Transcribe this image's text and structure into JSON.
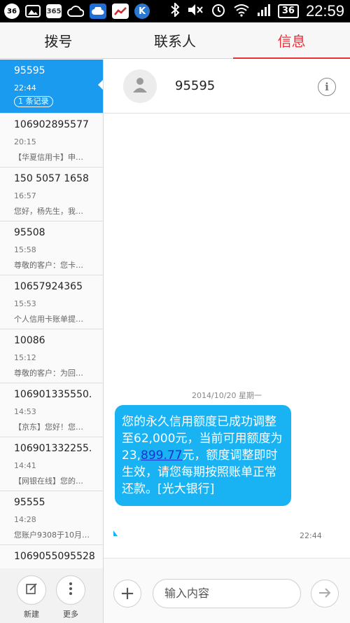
{
  "status_bar": {
    "icons": [
      "notification-badge-36",
      "image-icon",
      "calendar-365-icon",
      "cloud-icon",
      "cloud-sync-icon",
      "chart-icon",
      "k-icon"
    ],
    "calendar_label": "365",
    "notif_label": "36",
    "k_label": "K",
    "battery": "36",
    "time": "22:59"
  },
  "tabs": [
    {
      "label": "拨号",
      "active": false
    },
    {
      "label": "联系人",
      "active": false
    },
    {
      "label": "信息",
      "active": true
    }
  ],
  "conversations": [
    {
      "name": "95595",
      "time": "22:44",
      "snippet": "",
      "badge": "1 条记录",
      "selected": true
    },
    {
      "name": "106902895577",
      "time": "20:15",
      "snippet": "【华夏信用卡】申…",
      "badge": "",
      "selected": false
    },
    {
      "name": "150 5057 1658",
      "time": "16:57",
      "snippet": "您好，杨先生，我…",
      "badge": "",
      "selected": false
    },
    {
      "name": "95508",
      "time": "15:58",
      "snippet": "尊敬的客户：您卡…",
      "badge": "",
      "selected": false
    },
    {
      "name": "10657924365",
      "time": "15:53",
      "snippet": "个人信用卡账单提…",
      "badge": "",
      "selected": false
    },
    {
      "name": "10086",
      "time": "15:12",
      "snippet": "尊敬的客户：为回…",
      "badge": "",
      "selected": false
    },
    {
      "name": "106901335550.",
      "time": "14:53",
      "snippet": "【京东】您好！您…",
      "badge": "",
      "selected": false
    },
    {
      "name": "106901332255.",
      "time": "14:41",
      "snippet": "【网银在线】您的…",
      "badge": "",
      "selected": false
    },
    {
      "name": "95555",
      "time": "14:28",
      "snippet": "您账户9308于10月…",
      "badge": "",
      "selected": false
    },
    {
      "name": "1069055095528",
      "time": "",
      "snippet": "",
      "badge": "",
      "selected": false
    }
  ],
  "left_toolbar": {
    "new_label": "新建",
    "more_label": "更多"
  },
  "contact": {
    "name": "95595"
  },
  "thread": {
    "date": "2014/10/20  星期一",
    "message": {
      "before": "您的永久信用额度已成功调整至62,000元，当前可用额度为23,",
      "link": "899.77",
      "after": "元，额度调整即时生效，请您每期按照账单正常还款。[光大银行]",
      "time": "22:44"
    }
  },
  "composer": {
    "placeholder": "输入内容"
  },
  "colors": {
    "accent_red": "#e8303b",
    "selected_blue": "#1a9bf0",
    "bubble_blue": "#19b3f3"
  }
}
